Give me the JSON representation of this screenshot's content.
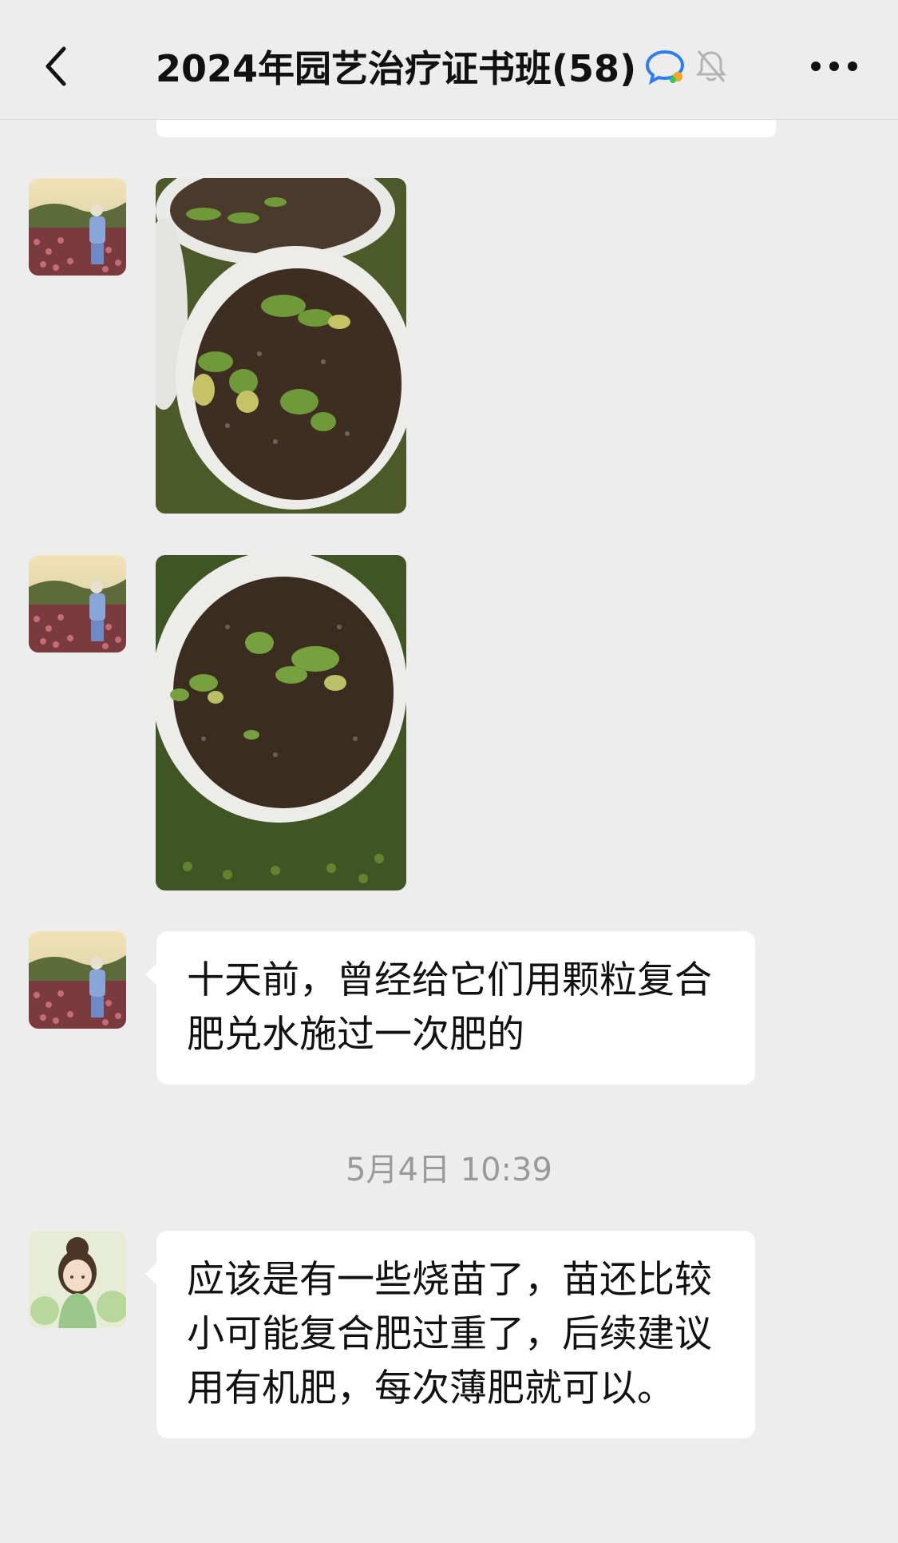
{
  "header": {
    "title": "2024年园艺治疗证书班(58)",
    "back_icon": "chevron-left-icon",
    "chat_icon": "chat-bubble-icon",
    "mute_icon": "bell-muted-icon",
    "more_icon": "more-dots-icon"
  },
  "messages": [
    {
      "sender": "member-1",
      "type": "image",
      "alt": "seedlings-in-pots-1"
    },
    {
      "sender": "member-1",
      "type": "image",
      "alt": "seedlings-in-pot-2"
    },
    {
      "sender": "member-1",
      "type": "text",
      "text": "十天前，曾经给它们用颗粒复合肥兑水施过一次肥的"
    },
    {
      "sender": "member-2",
      "type": "text",
      "text": "应该是有一些烧苗了，苗还比较小可能复合肥过重了，后续建议用有机肥，每次薄肥就可以。"
    }
  ],
  "timestamp": "5月4日 10:39",
  "colors": {
    "background": "#ededed",
    "bubble": "#ffffff",
    "title": "#111111",
    "timestamp": "#9a9a9a"
  }
}
